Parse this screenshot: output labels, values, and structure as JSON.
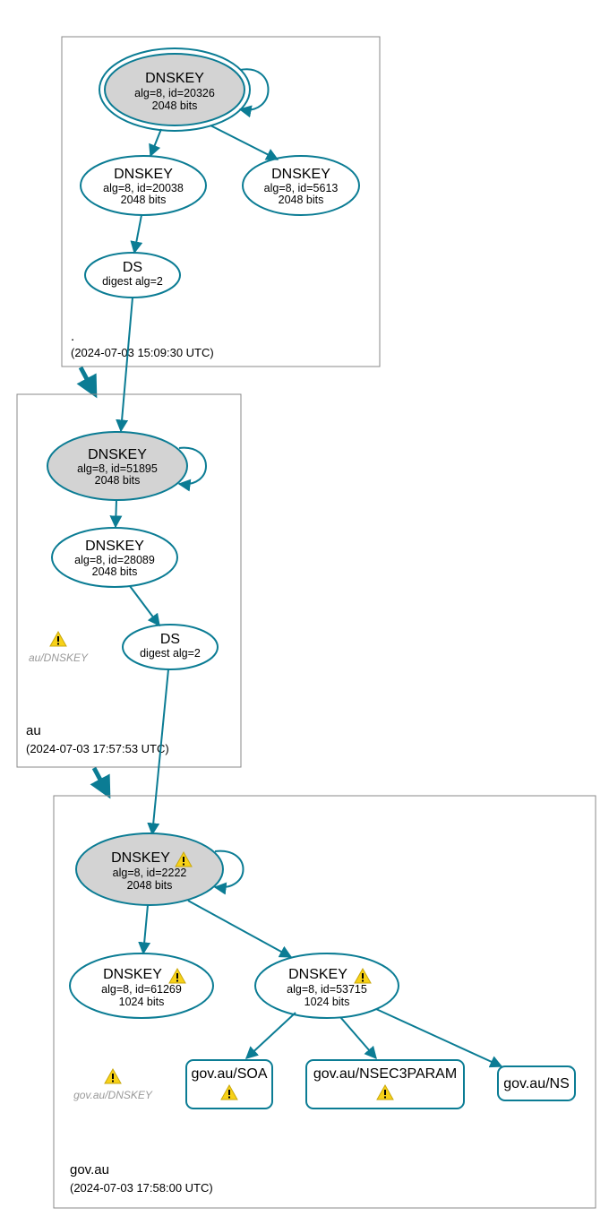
{
  "zones": {
    "root": {
      "label": ".",
      "timestamp": "(2024-07-03 15:09:30 UTC)"
    },
    "au": {
      "label": "au",
      "timestamp": "(2024-07-03 17:57:53 UTC)"
    },
    "govau": {
      "label": "gov.au",
      "timestamp": "(2024-07-03 17:58:00 UTC)"
    }
  },
  "nodes": {
    "root_ksk": {
      "title": "DNSKEY",
      "l1": "alg=8, id=20326",
      "l2": "2048 bits"
    },
    "root_zsk1": {
      "title": "DNSKEY",
      "l1": "alg=8, id=20038",
      "l2": "2048 bits"
    },
    "root_zsk2": {
      "title": "DNSKEY",
      "l1": "alg=8, id=5613",
      "l2": "2048 bits"
    },
    "root_ds": {
      "title": "DS",
      "l1": "digest alg=2",
      "l2": ""
    },
    "au_ksk": {
      "title": "DNSKEY",
      "l1": "alg=8, id=51895",
      "l2": "2048 bits"
    },
    "au_zsk": {
      "title": "DNSKEY",
      "l1": "alg=8, id=28089",
      "l2": "2048 bits"
    },
    "au_ds": {
      "title": "DS",
      "l1": "digest alg=2",
      "l2": ""
    },
    "au_warn": {
      "text": "au/DNSKEY"
    },
    "gov_ksk": {
      "title": "DNSKEY",
      "l1": "alg=8, id=2222",
      "l2": "2048 bits"
    },
    "gov_zsk1": {
      "title": "DNSKEY",
      "l1": "alg=8, id=61269",
      "l2": "1024 bits"
    },
    "gov_zsk2": {
      "title": "DNSKEY",
      "l1": "alg=8, id=53715",
      "l2": "1024 bits"
    },
    "gov_warn": {
      "text": "gov.au/DNSKEY"
    },
    "gov_soa": {
      "title": "gov.au/SOA"
    },
    "gov_nsec3": {
      "title": "gov.au/NSEC3PARAM"
    },
    "gov_ns": {
      "title": "gov.au/NS"
    }
  }
}
